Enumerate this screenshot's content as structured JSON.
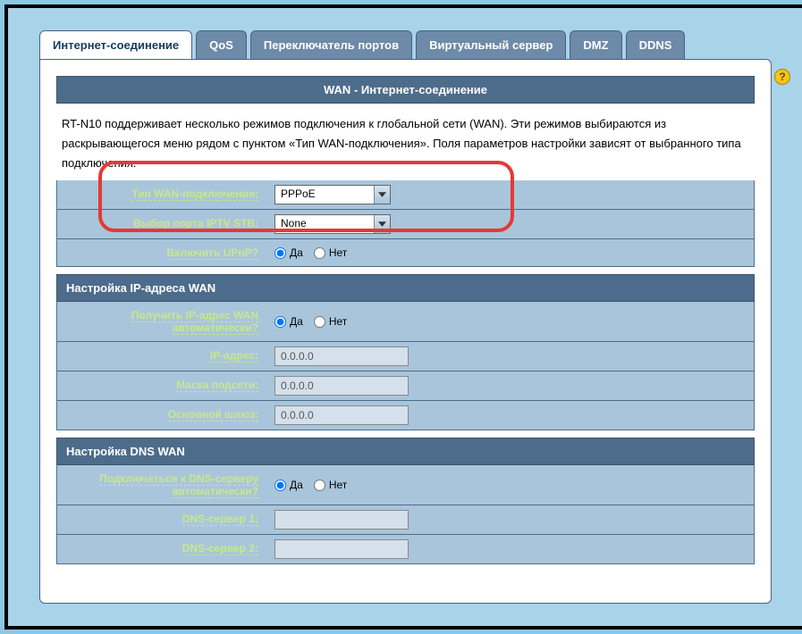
{
  "tabs": {
    "0": "Интернет-соединение",
    "1": "QoS",
    "2": "Переключатель портов",
    "3": "Виртуальный сервер",
    "4": "DMZ",
    "5": "DDNS"
  },
  "help_icon": "?",
  "title": "WAN - Интернет-соединение",
  "description": "RT-N10 поддерживает несколько режимов подключения к глобальной сети (WAN). Эти режимов выбираются из раскрывающегося меню рядом с пунктом «Тип WAN-подключения». Поля параметров настройки зависят от выбранного типа подключения.",
  "section1": {
    "wan_type_label": "Тип WAN-подключения:",
    "wan_type_value": "PPPoE",
    "iptv_label": "Выбор порта IPTV STB:",
    "iptv_value": "None",
    "upnp_label": "Включить UPnP?",
    "yes": "Да",
    "no": "Нет"
  },
  "section2": {
    "header": "Настройка IP-адреса WAN",
    "auto_label": "Получить IP-адрес WAN автоматически?",
    "ip_label": "IP-адрес:",
    "ip_value": "0.0.0.0",
    "mask_label": "Маска подсети:",
    "mask_value": "0.0.0.0",
    "gateway_label": "Основной шлюз:",
    "gateway_value": "0.0.0.0",
    "yes": "Да",
    "no": "Нет"
  },
  "section3": {
    "header": "Настройка DNS WAN",
    "auto_label": "Подключаться к DNS-серверу автоматически?",
    "dns1_label": "DNS-сервер 1:",
    "dns1_value": "",
    "dns2_label": "DNS-сервер 2:",
    "dns2_value": "",
    "yes": "Да",
    "no": "Нет"
  }
}
